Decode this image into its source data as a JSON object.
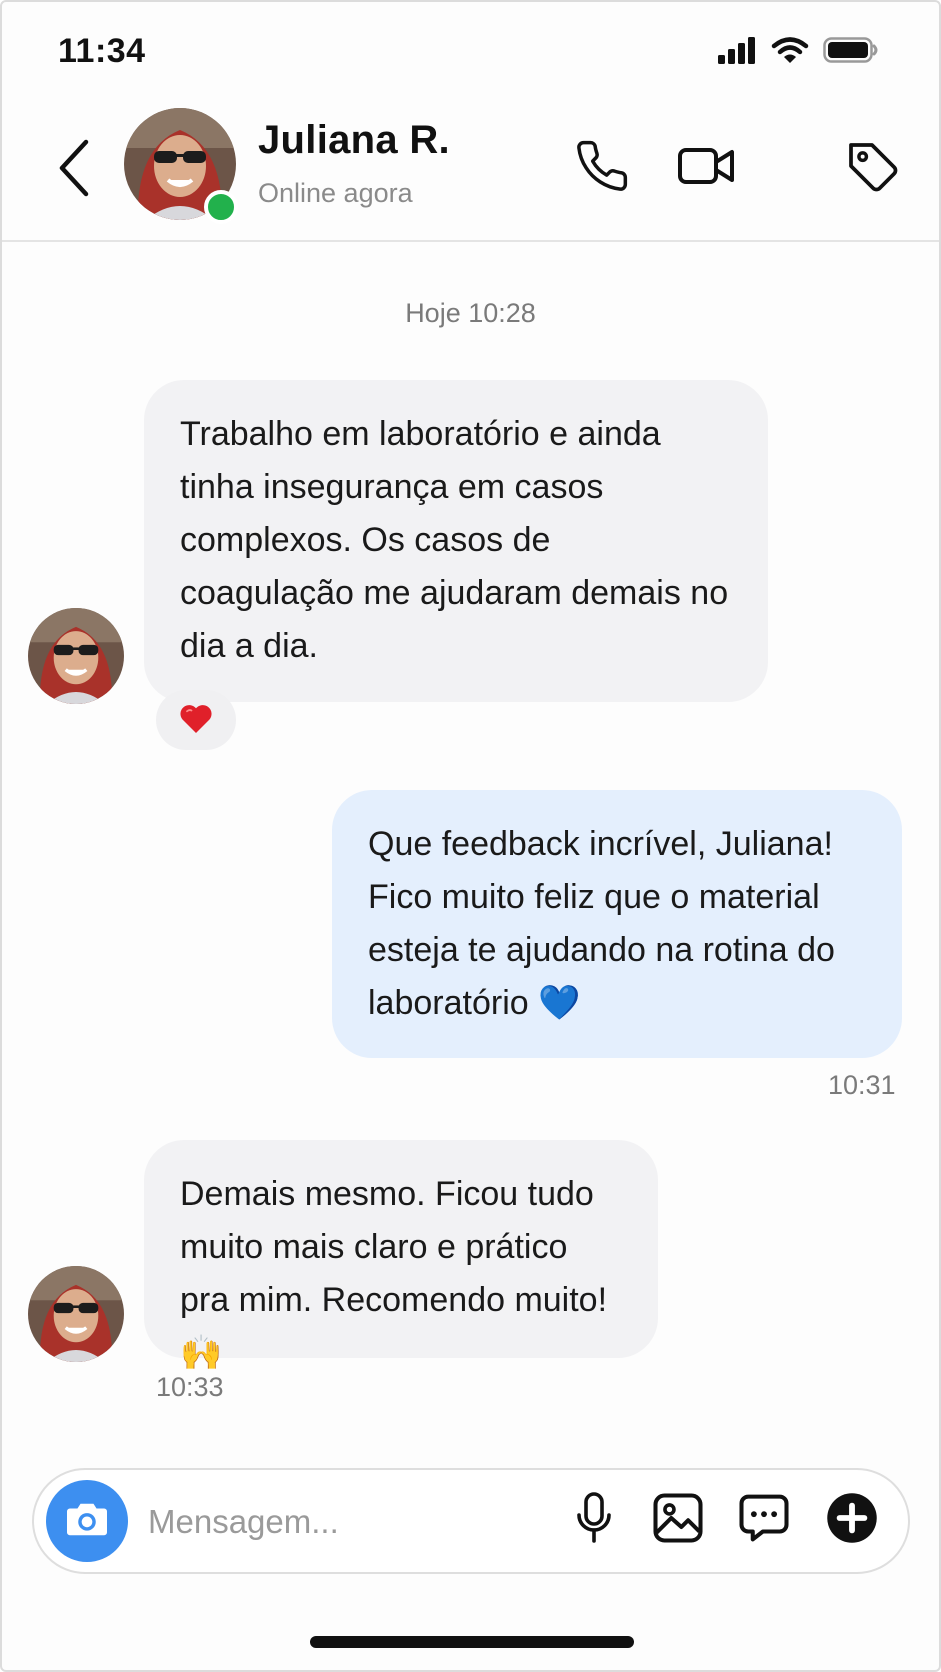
{
  "status_bar": {
    "time": "11:34"
  },
  "header": {
    "name": "Juliana R.",
    "status": "Online agora",
    "online": true,
    "icons": [
      "back-icon",
      "phone-icon",
      "video-camera-icon",
      "tag-icon"
    ]
  },
  "chat": {
    "date_separator": "Hoje 10:28",
    "messages": [
      {
        "direction": "incoming",
        "text": "Trabalho em laboratório e ainda tinha insegurança em casos complexos. Os casos de coagulação me ajudaram demais no dia a dia.",
        "reaction": "❤️"
      },
      {
        "direction": "outgoing",
        "text": "Que feedback incrível, Juliana! Fico muito feliz que o material esteja te ajudando na rotina do laboratório 💙",
        "time": "10:31"
      },
      {
        "direction": "incoming",
        "text": "Demais mesmo. Ficou tudo muito mais claro e prático pra mim. Recomendo muito! 🙌",
        "time": "10:33"
      }
    ]
  },
  "composer": {
    "placeholder": "Mensagem...",
    "icons": [
      "camera-icon",
      "microphone-icon",
      "image-icon",
      "message-options-icon",
      "plus-icon"
    ]
  },
  "colors": {
    "accent": "#3d8ff0",
    "online": "#22b14c",
    "incoming_bubble": "#f2f2f4",
    "outgoing_bubble": "#e4effd"
  }
}
